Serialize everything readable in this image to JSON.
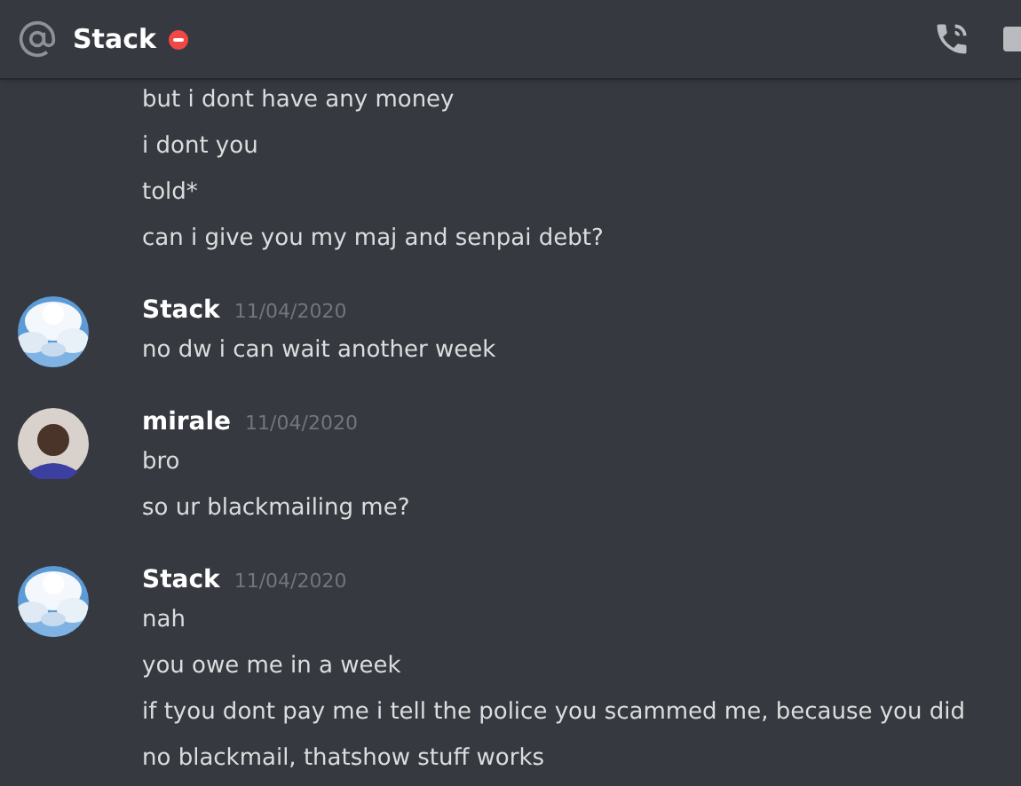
{
  "header": {
    "title": "Stack",
    "do_not_disturb": true
  },
  "messages": [
    {
      "lines": [
        "but i dont have any money",
        "i dont you",
        "told*",
        "can i give you my maj and senpai debt?"
      ]
    },
    {
      "author": "Stack",
      "timestamp": "11/04/2020",
      "avatar": {
        "kind": "picture"
      },
      "lines": [
        "no dw i can wait another week"
      ]
    },
    {
      "author": "mirale",
      "timestamp": "11/04/2020",
      "avatar": {
        "kind": "person"
      },
      "lines": [
        "bro",
        "so ur blackmailing me?"
      ]
    },
    {
      "author": "Stack",
      "timestamp": "11/04/2020",
      "avatar": {
        "kind": "picture"
      },
      "lines": [
        "nah",
        "you owe me in a week",
        "if tyou dont pay me i tell the police you scammed me, because you did",
        "no blackmail, thatshow stuff works"
      ]
    }
  ]
}
